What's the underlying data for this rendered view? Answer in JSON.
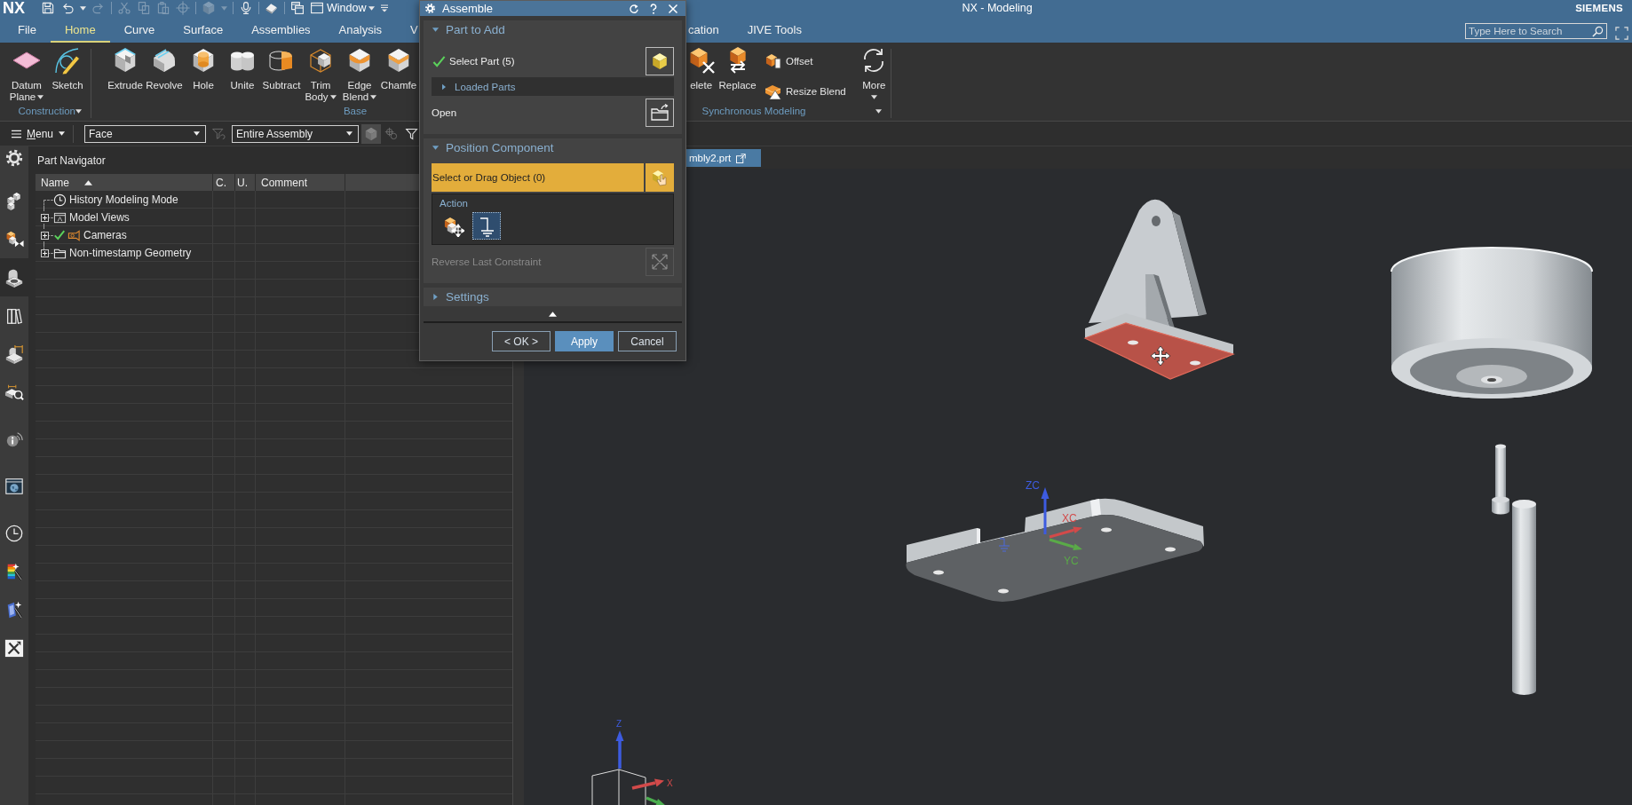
{
  "window": {
    "logo": "NX",
    "title": "NX - Modeling",
    "brand": "SIEMENS",
    "search_placeholder": "Type Here to Search"
  },
  "quick_access": {
    "tools": [
      {
        "disabled": false
      },
      {
        "disabled": false
      },
      {
        "disabled": true
      },
      {
        "disabled": true
      },
      {
        "disabled": true
      },
      {
        "disabled": true
      },
      {
        "disabled": true
      },
      {
        "disabled": true
      },
      {
        "disabled": false
      },
      {
        "disabled": false
      },
      {
        "disabled": false
      }
    ],
    "window_menu": "Window"
  },
  "ribbon": {
    "tabs": [
      {
        "label": "File",
        "selected": false
      },
      {
        "label": "Home",
        "selected": true
      },
      {
        "label": "Curve",
        "selected": false
      },
      {
        "label": "Surface",
        "selected": false
      },
      {
        "label": "Assemblies",
        "selected": false
      },
      {
        "label": "Analysis",
        "selected": false
      },
      {
        "label": "V",
        "selected": false
      }
    ],
    "tabs_right": [
      {
        "label": "cation",
        "selected": false
      },
      {
        "label": "JIVE Tools",
        "selected": false
      }
    ],
    "groups": [
      {
        "label": "Construction",
        "items": [
          {
            "label": "Datum Plane",
            "kind": "large",
            "dropdown": true
          },
          {
            "label": "Sketch",
            "kind": "large",
            "dropdown": false
          }
        ]
      },
      {
        "label": "Base",
        "items": [
          {
            "label": "Extrude",
            "kind": "large",
            "dropdown": false
          },
          {
            "label": "Revolve",
            "kind": "large",
            "dropdown": false
          },
          {
            "label": "Hole",
            "kind": "large",
            "dropdown": false
          },
          {
            "label": "Unite",
            "kind": "large",
            "dropdown": false
          },
          {
            "label": "Subtract",
            "kind": "large",
            "dropdown": false
          },
          {
            "label": "Trim Body",
            "kind": "large",
            "dropdown": true
          },
          {
            "label": "Edge Blend",
            "kind": "large",
            "dropdown": true
          },
          {
            "label": "Chamfe",
            "kind": "large",
            "dropdown": false
          }
        ]
      },
      {
        "label": "Synchronous Modeling",
        "items": [
          {
            "label": "elete",
            "kind": "large",
            "dropdown": false
          },
          {
            "label": "Replace",
            "kind": "large",
            "dropdown": false
          },
          {
            "label": "Offset",
            "kind": "small",
            "dropdown": false
          },
          {
            "label": "Resize Blend",
            "kind": "small",
            "dropdown": false
          },
          {
            "label": "More",
            "kind": "gallery",
            "dropdown": true
          }
        ]
      }
    ]
  },
  "selection_bar": {
    "menu": "Menu",
    "type_filter": "Face",
    "scope": "Entire Assembly",
    "tools": [
      {
        "disabled": true,
        "selected": false
      },
      {
        "disabled": true,
        "selected": true
      },
      {
        "disabled": true,
        "selected": false
      },
      {
        "disabled": false,
        "selected": false
      }
    ]
  },
  "resource_bar": [
    {
      "selected": false
    },
    {
      "selected": false
    },
    {
      "selected": true
    },
    {
      "selected": false
    },
    {
      "selected": false
    },
    {
      "selected": false
    },
    {
      "selected": false
    },
    {
      "selected": false
    },
    {
      "selected": false
    },
    {
      "selected": false
    },
    {
      "selected": false
    },
    {
      "selected": false
    }
  ],
  "part_navigator": {
    "title": "Part Navigator",
    "columns": [
      {
        "label": "Name",
        "sorted": true
      },
      {
        "label": "C.",
        "sorted": false
      },
      {
        "label": "U.",
        "sorted": false
      },
      {
        "label": "Comment",
        "sorted": false
      }
    ],
    "rows": [
      {
        "label": "History Modeling Mode",
        "kind": "leaf",
        "checked": false
      },
      {
        "label": "Model Views",
        "kind": "branch",
        "expanded": false,
        "checked": false
      },
      {
        "label": "Cameras",
        "kind": "branch",
        "expanded": false,
        "checked": true
      },
      {
        "label": "Non-timestamp Geometry",
        "kind": "branch",
        "expanded": false,
        "checked": false
      }
    ]
  },
  "document_tab": {
    "label": "mbly2.prt",
    "selected": true
  },
  "viewport": {
    "selected_face": true,
    "wcs": [
      {
        "label": "ZC",
        "color": "#3d5be0"
      },
      {
        "label": "XC",
        "color": "#d24a4a"
      },
      {
        "label": "YC",
        "color": "#5aaa48"
      }
    ],
    "triad": [
      {
        "label": "Z",
        "color": "#3d5be0"
      },
      {
        "label": "X",
        "color": "#d24a4a"
      }
    ]
  },
  "dialog": {
    "title": "Assemble",
    "part_to_add": {
      "title": "Part to Add",
      "expanded": true,
      "select_label": "Select Part (5)",
      "selection_done": true,
      "loaded_parts": {
        "label": "Loaded Parts",
        "expanded": false
      },
      "open_label": "Open"
    },
    "position_component": {
      "title": "Position Component",
      "expanded": true,
      "select_label": "Select or Drag Object (0)",
      "active": true,
      "action_label": "Action",
      "actions": [
        {
          "selected": false
        },
        {
          "selected": true
        }
      ],
      "reverse_label": "Reverse Last Constraint",
      "reverse_disabled": true
    },
    "settings": {
      "title": "Settings",
      "expanded": false
    },
    "buttons": [
      {
        "label": "< OK >",
        "kind": "default"
      },
      {
        "label": "Apply",
        "kind": "primary"
      },
      {
        "label": "Cancel",
        "kind": "default"
      }
    ]
  }
}
